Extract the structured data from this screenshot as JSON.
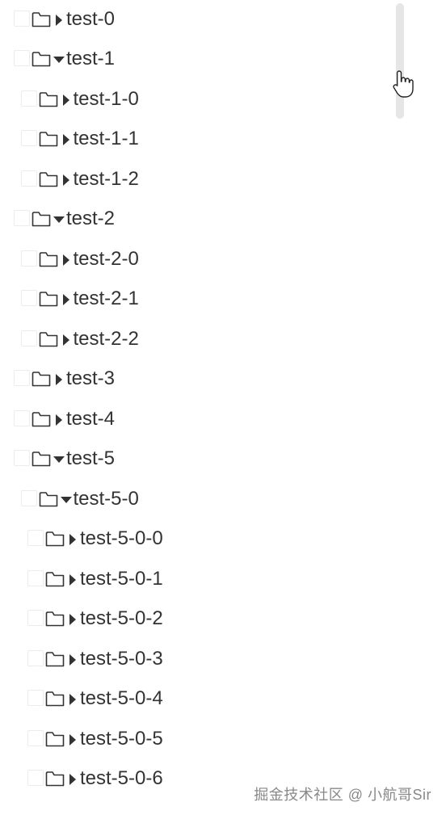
{
  "tree": {
    "nodes": [
      {
        "label": "test-0",
        "level": 0,
        "expanded": false
      },
      {
        "label": "test-1",
        "level": 0,
        "expanded": true
      },
      {
        "label": "test-1-0",
        "level": 1,
        "expanded": false
      },
      {
        "label": "test-1-1",
        "level": 1,
        "expanded": false
      },
      {
        "label": "test-1-2",
        "level": 1,
        "expanded": false
      },
      {
        "label": "test-2",
        "level": 0,
        "expanded": true
      },
      {
        "label": "test-2-0",
        "level": 1,
        "expanded": false
      },
      {
        "label": "test-2-1",
        "level": 1,
        "expanded": false
      },
      {
        "label": "test-2-2",
        "level": 1,
        "expanded": false
      },
      {
        "label": "test-3",
        "level": 0,
        "expanded": false
      },
      {
        "label": "test-4",
        "level": 0,
        "expanded": false
      },
      {
        "label": "test-5",
        "level": 0,
        "expanded": true
      },
      {
        "label": "test-5-0",
        "level": 1,
        "expanded": true
      },
      {
        "label": "test-5-0-0",
        "level": 2,
        "expanded": false
      },
      {
        "label": "test-5-0-1",
        "level": 2,
        "expanded": false
      },
      {
        "label": "test-5-0-2",
        "level": 2,
        "expanded": false
      },
      {
        "label": "test-5-0-3",
        "level": 2,
        "expanded": false
      },
      {
        "label": "test-5-0-4",
        "level": 2,
        "expanded": false
      },
      {
        "label": "test-5-0-5",
        "level": 2,
        "expanded": false
      },
      {
        "label": "test-5-0-6",
        "level": 2,
        "expanded": false
      }
    ]
  },
  "icons": {
    "folder": "folder-icon",
    "caret_collapsed": "caret-right-icon",
    "caret_expanded": "caret-down-icon",
    "cursor": "hand-pointer-icon"
  },
  "watermark": "掘金技术社区 @ 小航哥Sir",
  "colors": {
    "text": "#333333",
    "checkbox_border": "#ececec",
    "scrollbar": "#e6e6e6"
  }
}
